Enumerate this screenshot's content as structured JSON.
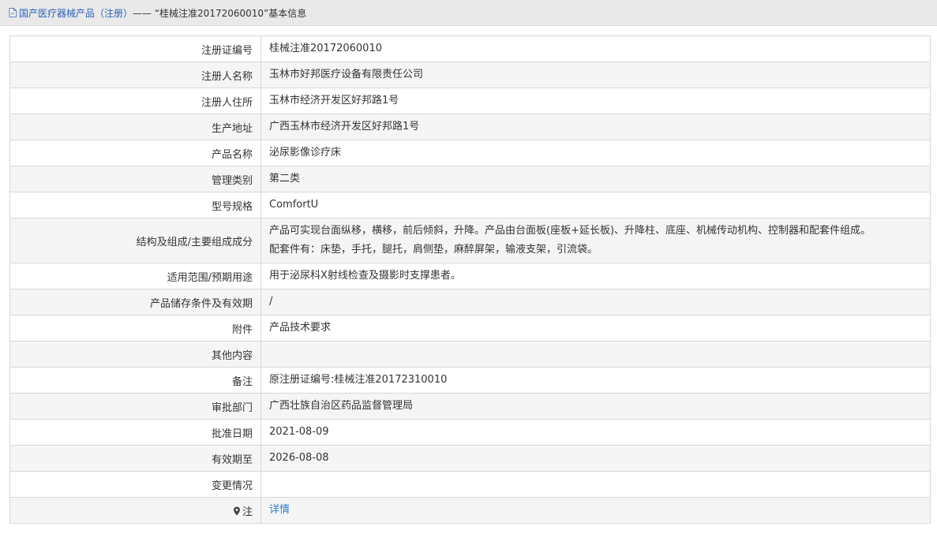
{
  "header": {
    "link_text": "国产医疗器械产品（注册）",
    "rest_text": " —— “桂械注准20172060010”基本信息",
    "icon": "document-icon"
  },
  "rows": [
    {
      "label": "注册证编号",
      "value": "桂械注准20172060010"
    },
    {
      "label": "注册人名称",
      "value": "玉林市好邦医疗设备有限责任公司"
    },
    {
      "label": "注册人住所",
      "value": "玉林市经济开发区好邦路1号"
    },
    {
      "label": "生产地址",
      "value": "广西玉林市经济开发区好邦路1号"
    },
    {
      "label": "产品名称",
      "value": "泌尿影像诊疗床"
    },
    {
      "label": "管理类别",
      "value": "第二类"
    },
    {
      "label": "型号规格",
      "value": "ComfortU"
    },
    {
      "label": "结构及组成/主要组成成分",
      "value_line1": "产品可实现台面纵移，横移，前后倾斜，升降。产品由台面板(座板+延长板)、升降柱、底座、机械传动机构、控制器和配套件组成。",
      "value_line2": "配套件有：床垫，手托，腿托，肩侧垫，麻醉屏架，输液支架，引流袋。"
    },
    {
      "label": "适用范围/预期用途",
      "value": "用于泌尿科X射线检查及摄影时支撑患者。"
    },
    {
      "label": "产品储存条件及有效期",
      "value": "/"
    },
    {
      "label": "附件",
      "value": "产品技术要求"
    },
    {
      "label": "其他内容",
      "value": ""
    },
    {
      "label": "备注",
      "value": "原注册证编号:桂械注准20172310010"
    },
    {
      "label": "审批部门",
      "value": "广西壮族自治区药品监督管理局"
    },
    {
      "label": "批准日期",
      "value": "2021-08-09"
    },
    {
      "label": "有效期至",
      "value": "2026-08-08"
    },
    {
      "label": "变更情况",
      "value": ""
    },
    {
      "label": "注",
      "label_icon": "pin-icon",
      "value": "详情"
    }
  ],
  "colors": {
    "link": "#2a79c9",
    "header_bg": "#e9e9e9",
    "row_alt_bg": "#f5f5f5",
    "border": "#d8d8d8"
  }
}
